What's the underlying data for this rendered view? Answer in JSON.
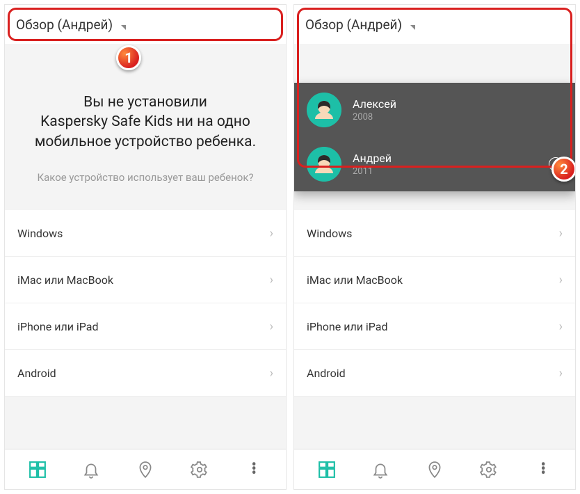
{
  "left": {
    "header_title": "Обзор (Андрей)",
    "intro_line1": "Вы не установили",
    "intro_line2": "Kaspersky Safe Kids ни на одно",
    "intro_line3": "мобильное устройство ребенка.",
    "question": "Какое устройство использует ваш ребенок?",
    "badge": "1"
  },
  "right": {
    "header_title": "Обзор (Андрей)",
    "intro_line1": "Вы не установили",
    "intro_line2": "Kaspersky Safe Kids ни на одно",
    "intro_line3": "мобильное устройство ребенка.",
    "question": "Какое устройство использует ваш ребенок?",
    "badge": "2",
    "profiles": [
      {
        "name": "Алексей",
        "year": "2008",
        "selected": false
      },
      {
        "name": "Андрей",
        "year": "2011",
        "selected": true
      }
    ]
  },
  "devices": [
    {
      "label": "Windows"
    },
    {
      "label": "iMac или MacBook"
    },
    {
      "label": "iPhone или iPad"
    },
    {
      "label": "Android"
    }
  ],
  "nav": {
    "overview": "overview-icon",
    "bell": "bell-icon",
    "location": "location-icon",
    "settings": "settings-icon",
    "more": "more-icon"
  }
}
